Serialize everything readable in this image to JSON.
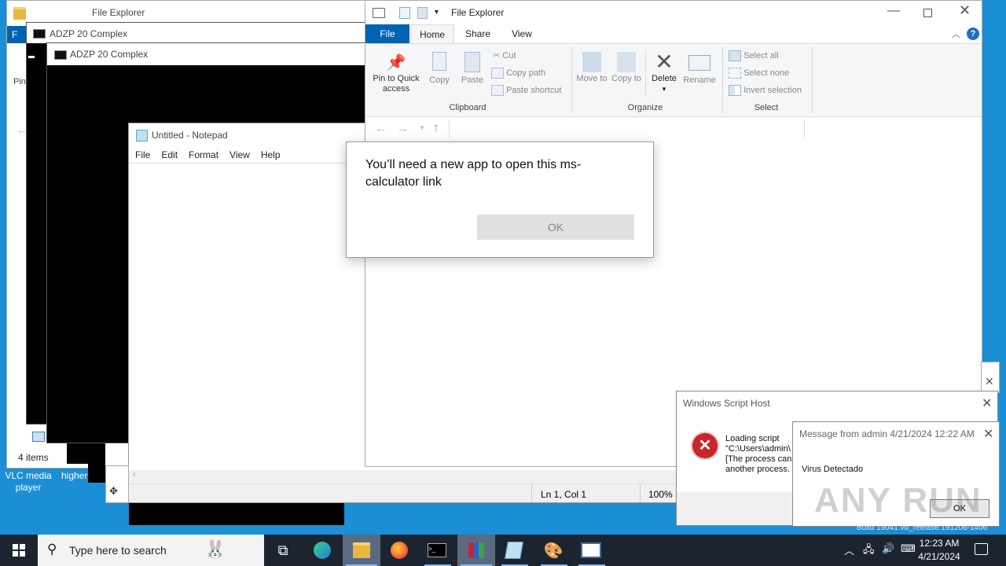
{
  "explorer_back": {
    "title": "File Explorer",
    "tab_file_short": "F",
    "pin_short": "Pin",
    "items_count": "4 items"
  },
  "console1": {
    "title": "ADZP 20 Complex"
  },
  "console2": {
    "title": "ADZP 20 Complex"
  },
  "notepad": {
    "title": "Untitled - Notepad",
    "menu": [
      "File",
      "Edit",
      "Format",
      "View",
      "Help"
    ],
    "status_pos": "Ln 1, Col 1",
    "status_zoom": "100%"
  },
  "explorer_front": {
    "title": "File Explorer",
    "tabs": [
      "File",
      "Home",
      "Share",
      "View"
    ],
    "clipboard": {
      "pin": "Pin to Quick access",
      "copy": "Copy",
      "paste": "Paste",
      "cut": "Cut",
      "copy_path": "Copy path",
      "paste_shortcut": "Paste shortcut",
      "group": "Clipboard"
    },
    "organize": {
      "move": "Move to",
      "copy": "Copy to",
      "delete": "Delete",
      "rename": "Rename",
      "group": "Organize"
    },
    "select": {
      "all": "Select all",
      "none": "Select none",
      "invert": "Invert selection",
      "group": "Select"
    }
  },
  "app_dialog": {
    "message": "You’ll need a new app to open this ms-calculator link",
    "ok": "OK"
  },
  "wsh": {
    "title": "Windows Script Host",
    "line1": "Loading script",
    "line2": "\"C:\\Users\\admin\\",
    "line3": "[The process can",
    "line4": "another process."
  },
  "msg": {
    "title": "Message from admin 4/21/2024 12:22 AM",
    "body": "Virus Detectado",
    "ok": "OK"
  },
  "desktop": {
    "vlc_label": "VLC media player",
    "higher_label": "higher",
    "build_text": "Build 19041.vb_release.191206-1406"
  },
  "taskbar": {
    "search_placeholder": "Type here to search",
    "time": "12:23 AM",
    "date": "4/21/2024"
  },
  "watermark": "ANY RUN",
  "colors": {
    "accent": "#0063b1",
    "taskbar": "#1c2430",
    "desktop": "#1a8fd6"
  }
}
